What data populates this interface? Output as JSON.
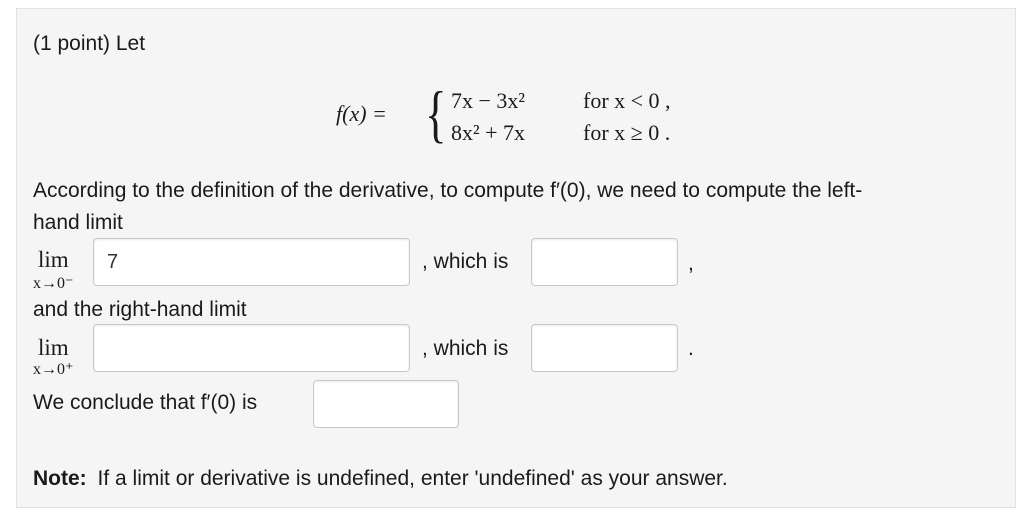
{
  "problem": {
    "header": "(1 point) Let",
    "function": {
      "lhs": "f(x) =",
      "brace": "{",
      "case1_expr": "7x − 3x²",
      "case1_cond": "for x < 0 ,",
      "case2_expr": "8x² + 7x",
      "case2_cond": "for x ≥ 0 ."
    },
    "instruction_line1": "According to the definition of the derivative, to compute f′(0), we need to compute the left-",
    "instruction_line2": "hand limit",
    "left_limit": {
      "lim": "lim",
      "sub": "x→0⁻",
      "input_value": "7",
      "which_is": ", which is",
      "trailing": ","
    },
    "right_label": "and the right-hand limit",
    "right_limit": {
      "lim": "lim",
      "sub": "x→0⁺",
      "input_value": "",
      "which_is": ", which is",
      "trailing": "."
    },
    "conclusion": "We conclude that f′(0) is",
    "conclusion_value": "",
    "note_label": "Note:",
    "note_text": "If a limit or derivative is undefined, enter 'undefined' as your answer."
  }
}
